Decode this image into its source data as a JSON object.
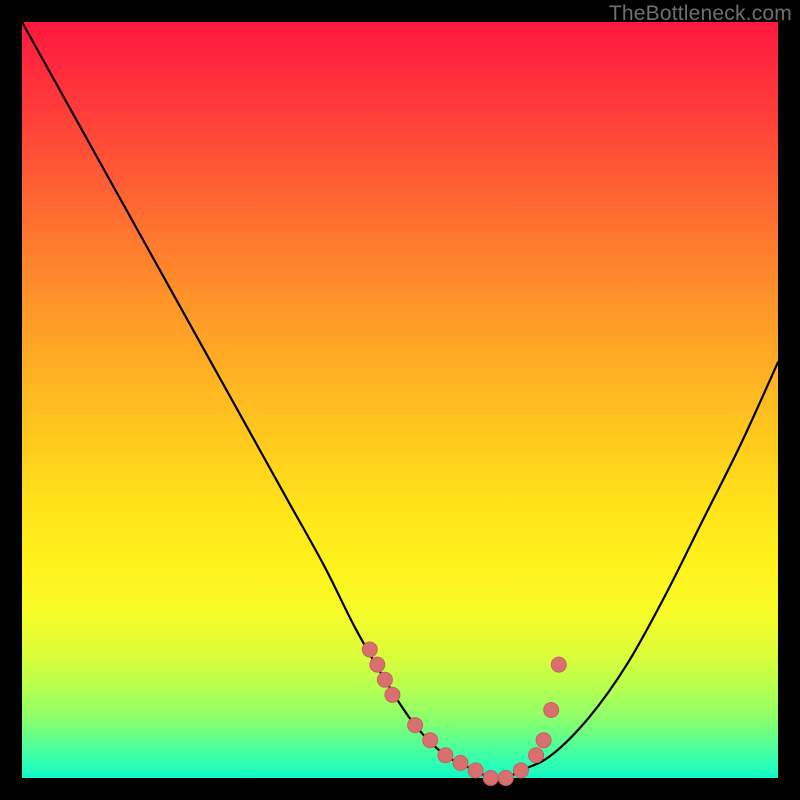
{
  "attribution": "TheBottleneck.com",
  "colors": {
    "top": "#ff183f",
    "mid": "#ffe31a",
    "bottom": "#10f7c6",
    "curve": "#000000",
    "marker": "#d87070",
    "frame": "#000000"
  },
  "chart_data": {
    "type": "line",
    "title": "",
    "subtitle": "",
    "xlabel": "",
    "ylabel": "",
    "xlim": [
      0,
      100
    ],
    "ylim": [
      0,
      100
    ],
    "grid": false,
    "legend": false,
    "series": [
      {
        "name": "bottleneck_curve",
        "x": [
          0,
          5,
          10,
          15,
          20,
          25,
          30,
          35,
          40,
          44,
          48,
          52,
          56,
          60,
          62,
          64,
          66,
          70,
          75,
          80,
          85,
          90,
          95,
          100
        ],
        "y": [
          100,
          91,
          82,
          73,
          64,
          55,
          46,
          37,
          28,
          20,
          13,
          7,
          3,
          1,
          0,
          0,
          1,
          3,
          8,
          15,
          24,
          34,
          44,
          55
        ]
      }
    ],
    "markers": {
      "name": "highlighted_points",
      "x": [
        46,
        47,
        48,
        49,
        52,
        54,
        56,
        58,
        60,
        62,
        64,
        66,
        68,
        69,
        70,
        71
      ],
      "y": [
        17,
        15,
        13,
        11,
        7,
        5,
        3,
        2,
        1,
        0,
        0,
        1,
        3,
        5,
        9,
        15
      ]
    },
    "background_gradient_meaning": "red_high_bottleneck_to_green_low_bottleneck"
  }
}
